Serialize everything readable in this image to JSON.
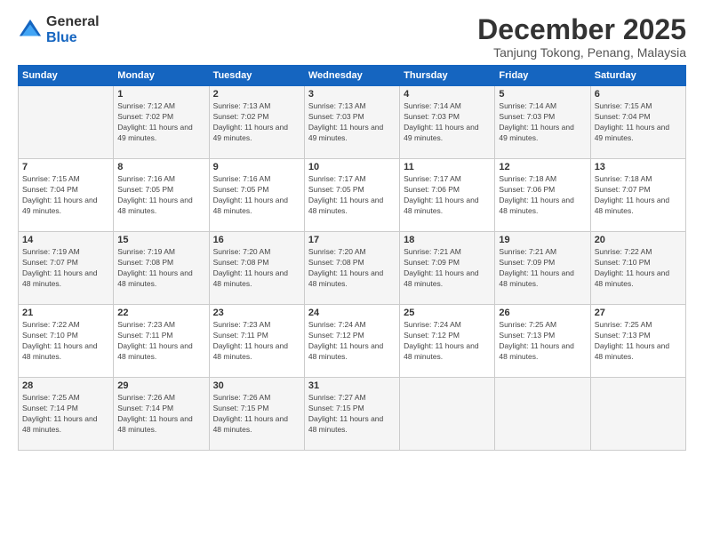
{
  "header": {
    "logo_general": "General",
    "logo_blue": "Blue",
    "month_title": "December 2025",
    "location": "Tanjung Tokong, Penang, Malaysia"
  },
  "days_of_week": [
    "Sunday",
    "Monday",
    "Tuesday",
    "Wednesday",
    "Thursday",
    "Friday",
    "Saturday"
  ],
  "weeks": [
    [
      {
        "day": "",
        "sunrise": "",
        "sunset": "",
        "daylight": ""
      },
      {
        "day": "1",
        "sunrise": "Sunrise: 7:12 AM",
        "sunset": "Sunset: 7:02 PM",
        "daylight": "Daylight: 11 hours and 49 minutes."
      },
      {
        "day": "2",
        "sunrise": "Sunrise: 7:13 AM",
        "sunset": "Sunset: 7:02 PM",
        "daylight": "Daylight: 11 hours and 49 minutes."
      },
      {
        "day": "3",
        "sunrise": "Sunrise: 7:13 AM",
        "sunset": "Sunset: 7:03 PM",
        "daylight": "Daylight: 11 hours and 49 minutes."
      },
      {
        "day": "4",
        "sunrise": "Sunrise: 7:14 AM",
        "sunset": "Sunset: 7:03 PM",
        "daylight": "Daylight: 11 hours and 49 minutes."
      },
      {
        "day": "5",
        "sunrise": "Sunrise: 7:14 AM",
        "sunset": "Sunset: 7:03 PM",
        "daylight": "Daylight: 11 hours and 49 minutes."
      },
      {
        "day": "6",
        "sunrise": "Sunrise: 7:15 AM",
        "sunset": "Sunset: 7:04 PM",
        "daylight": "Daylight: 11 hours and 49 minutes."
      }
    ],
    [
      {
        "day": "7",
        "sunrise": "Sunrise: 7:15 AM",
        "sunset": "Sunset: 7:04 PM",
        "daylight": "Daylight: 11 hours and 49 minutes."
      },
      {
        "day": "8",
        "sunrise": "Sunrise: 7:16 AM",
        "sunset": "Sunset: 7:05 PM",
        "daylight": "Daylight: 11 hours and 48 minutes."
      },
      {
        "day": "9",
        "sunrise": "Sunrise: 7:16 AM",
        "sunset": "Sunset: 7:05 PM",
        "daylight": "Daylight: 11 hours and 48 minutes."
      },
      {
        "day": "10",
        "sunrise": "Sunrise: 7:17 AM",
        "sunset": "Sunset: 7:05 PM",
        "daylight": "Daylight: 11 hours and 48 minutes."
      },
      {
        "day": "11",
        "sunrise": "Sunrise: 7:17 AM",
        "sunset": "Sunset: 7:06 PM",
        "daylight": "Daylight: 11 hours and 48 minutes."
      },
      {
        "day": "12",
        "sunrise": "Sunrise: 7:18 AM",
        "sunset": "Sunset: 7:06 PM",
        "daylight": "Daylight: 11 hours and 48 minutes."
      },
      {
        "day": "13",
        "sunrise": "Sunrise: 7:18 AM",
        "sunset": "Sunset: 7:07 PM",
        "daylight": "Daylight: 11 hours and 48 minutes."
      }
    ],
    [
      {
        "day": "14",
        "sunrise": "Sunrise: 7:19 AM",
        "sunset": "Sunset: 7:07 PM",
        "daylight": "Daylight: 11 hours and 48 minutes."
      },
      {
        "day": "15",
        "sunrise": "Sunrise: 7:19 AM",
        "sunset": "Sunset: 7:08 PM",
        "daylight": "Daylight: 11 hours and 48 minutes."
      },
      {
        "day": "16",
        "sunrise": "Sunrise: 7:20 AM",
        "sunset": "Sunset: 7:08 PM",
        "daylight": "Daylight: 11 hours and 48 minutes."
      },
      {
        "day": "17",
        "sunrise": "Sunrise: 7:20 AM",
        "sunset": "Sunset: 7:08 PM",
        "daylight": "Daylight: 11 hours and 48 minutes."
      },
      {
        "day": "18",
        "sunrise": "Sunrise: 7:21 AM",
        "sunset": "Sunset: 7:09 PM",
        "daylight": "Daylight: 11 hours and 48 minutes."
      },
      {
        "day": "19",
        "sunrise": "Sunrise: 7:21 AM",
        "sunset": "Sunset: 7:09 PM",
        "daylight": "Daylight: 11 hours and 48 minutes."
      },
      {
        "day": "20",
        "sunrise": "Sunrise: 7:22 AM",
        "sunset": "Sunset: 7:10 PM",
        "daylight": "Daylight: 11 hours and 48 minutes."
      }
    ],
    [
      {
        "day": "21",
        "sunrise": "Sunrise: 7:22 AM",
        "sunset": "Sunset: 7:10 PM",
        "daylight": "Daylight: 11 hours and 48 minutes."
      },
      {
        "day": "22",
        "sunrise": "Sunrise: 7:23 AM",
        "sunset": "Sunset: 7:11 PM",
        "daylight": "Daylight: 11 hours and 48 minutes."
      },
      {
        "day": "23",
        "sunrise": "Sunrise: 7:23 AM",
        "sunset": "Sunset: 7:11 PM",
        "daylight": "Daylight: 11 hours and 48 minutes."
      },
      {
        "day": "24",
        "sunrise": "Sunrise: 7:24 AM",
        "sunset": "Sunset: 7:12 PM",
        "daylight": "Daylight: 11 hours and 48 minutes."
      },
      {
        "day": "25",
        "sunrise": "Sunrise: 7:24 AM",
        "sunset": "Sunset: 7:12 PM",
        "daylight": "Daylight: 11 hours and 48 minutes."
      },
      {
        "day": "26",
        "sunrise": "Sunrise: 7:25 AM",
        "sunset": "Sunset: 7:13 PM",
        "daylight": "Daylight: 11 hours and 48 minutes."
      },
      {
        "day": "27",
        "sunrise": "Sunrise: 7:25 AM",
        "sunset": "Sunset: 7:13 PM",
        "daylight": "Daylight: 11 hours and 48 minutes."
      }
    ],
    [
      {
        "day": "28",
        "sunrise": "Sunrise: 7:25 AM",
        "sunset": "Sunset: 7:14 PM",
        "daylight": "Daylight: 11 hours and 48 minutes."
      },
      {
        "day": "29",
        "sunrise": "Sunrise: 7:26 AM",
        "sunset": "Sunset: 7:14 PM",
        "daylight": "Daylight: 11 hours and 48 minutes."
      },
      {
        "day": "30",
        "sunrise": "Sunrise: 7:26 AM",
        "sunset": "Sunset: 7:15 PM",
        "daylight": "Daylight: 11 hours and 48 minutes."
      },
      {
        "day": "31",
        "sunrise": "Sunrise: 7:27 AM",
        "sunset": "Sunset: 7:15 PM",
        "daylight": "Daylight: 11 hours and 48 minutes."
      },
      {
        "day": "",
        "sunrise": "",
        "sunset": "",
        "daylight": ""
      },
      {
        "day": "",
        "sunrise": "",
        "sunset": "",
        "daylight": ""
      },
      {
        "day": "",
        "sunrise": "",
        "sunset": "",
        "daylight": ""
      }
    ]
  ]
}
